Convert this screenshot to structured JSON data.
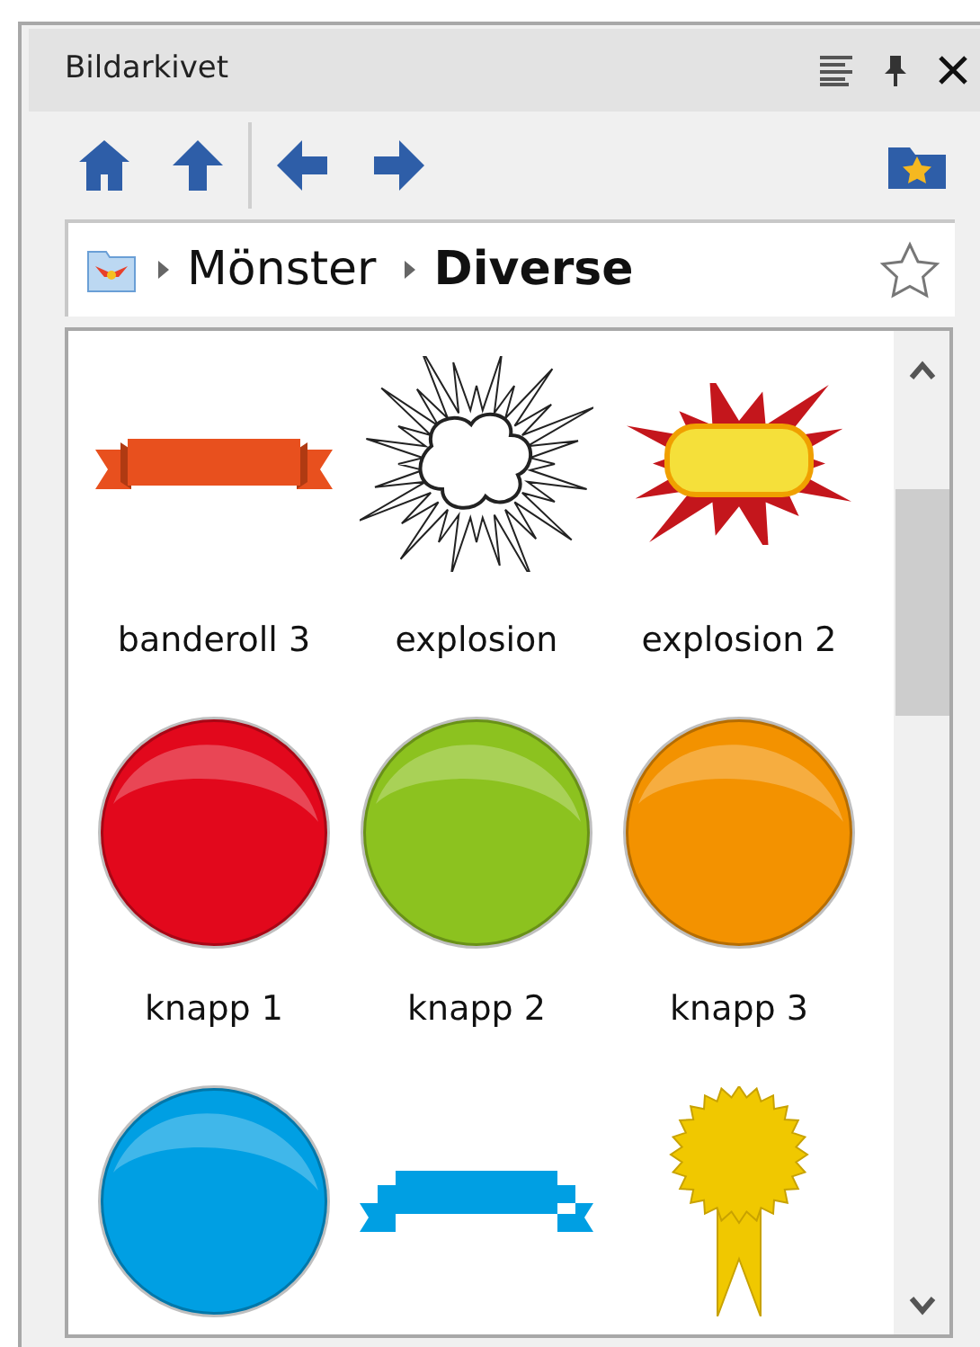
{
  "panel": {
    "title": "Bildarkivet"
  },
  "breadcrumb": [
    {
      "label": "Mönster",
      "current": false
    },
    {
      "label": "Diverse",
      "current": true
    }
  ],
  "bookmarked": false,
  "gallery": [
    {
      "kind": "banner",
      "label": "banderoll 3",
      "color": "#e8501e"
    },
    {
      "kind": "burst",
      "label": "explosion",
      "color": "#ffffff"
    },
    {
      "kind": "burst2",
      "label": "explosion 2",
      "color": "#f5e03a"
    },
    {
      "kind": "button",
      "label": "knapp 1",
      "color": "#e2081c"
    },
    {
      "kind": "button",
      "label": "knapp 2",
      "color": "#8cc21f"
    },
    {
      "kind": "button",
      "label": "knapp 3",
      "color": "#f39200"
    },
    {
      "kind": "button",
      "color": "#009fe3"
    },
    {
      "kind": "ribbon",
      "color": "#009fe3"
    },
    {
      "kind": "rosette",
      "color": "#f0c800"
    }
  ]
}
